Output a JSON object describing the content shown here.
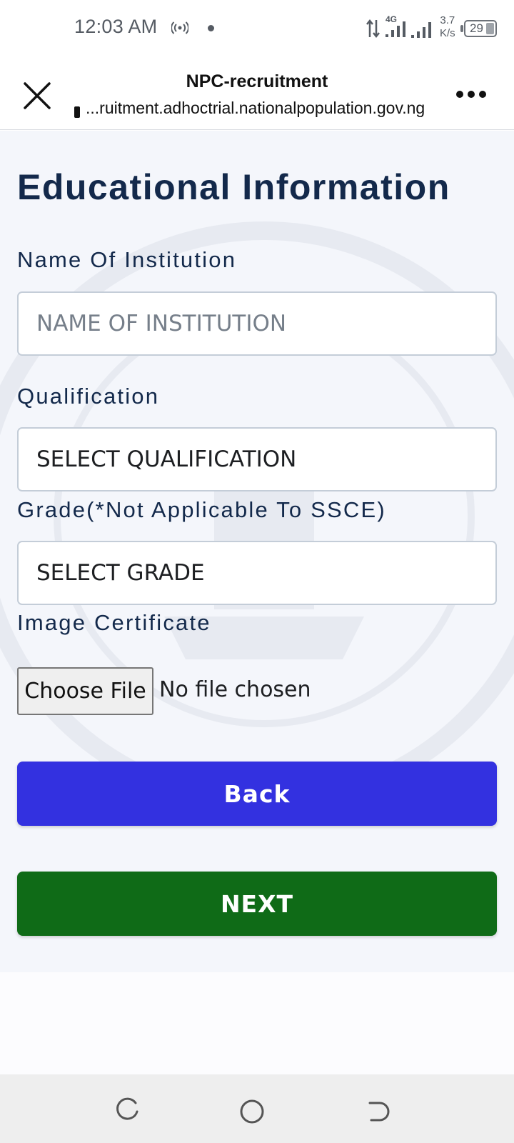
{
  "status_bar": {
    "time": "12:03 AM",
    "network_type": "4G",
    "speed_value": "3.7",
    "speed_unit": "K/s",
    "battery": "29",
    "icons": [
      "hotspot-icon",
      "notification-dot-icon",
      "data-arrows-icon",
      "signal-icon",
      "signal-icon",
      "battery-icon"
    ]
  },
  "browser": {
    "title": "NPC-recruitment",
    "url": "...ruitment.adhoctrial.nationalpopulation.gov.ng",
    "close_icon": "close-icon",
    "more_icon": "more-icon"
  },
  "form": {
    "heading": "Educational Information",
    "institution": {
      "label": "Name Of Institution",
      "placeholder": "NAME OF INSTITUTION"
    },
    "qualification": {
      "label": "Qualification",
      "selected": "SELECT QUALIFICATION"
    },
    "grade": {
      "label": "Grade(*Not Applicable To SSCE)",
      "selected": "SELECT GRADE"
    },
    "certificate": {
      "label": "Image Certificate",
      "button": "Choose File",
      "status": "No file chosen"
    },
    "back_label": "Back",
    "next_label": "NEXT"
  },
  "colors": {
    "heading": "#13294b",
    "back_button": "#3331e0",
    "next_button": "#0f6b17",
    "content_bg": "#f4f6fb"
  },
  "nav_bar": {
    "icons": [
      "recent-apps-icon",
      "home-icon",
      "back-icon"
    ]
  }
}
